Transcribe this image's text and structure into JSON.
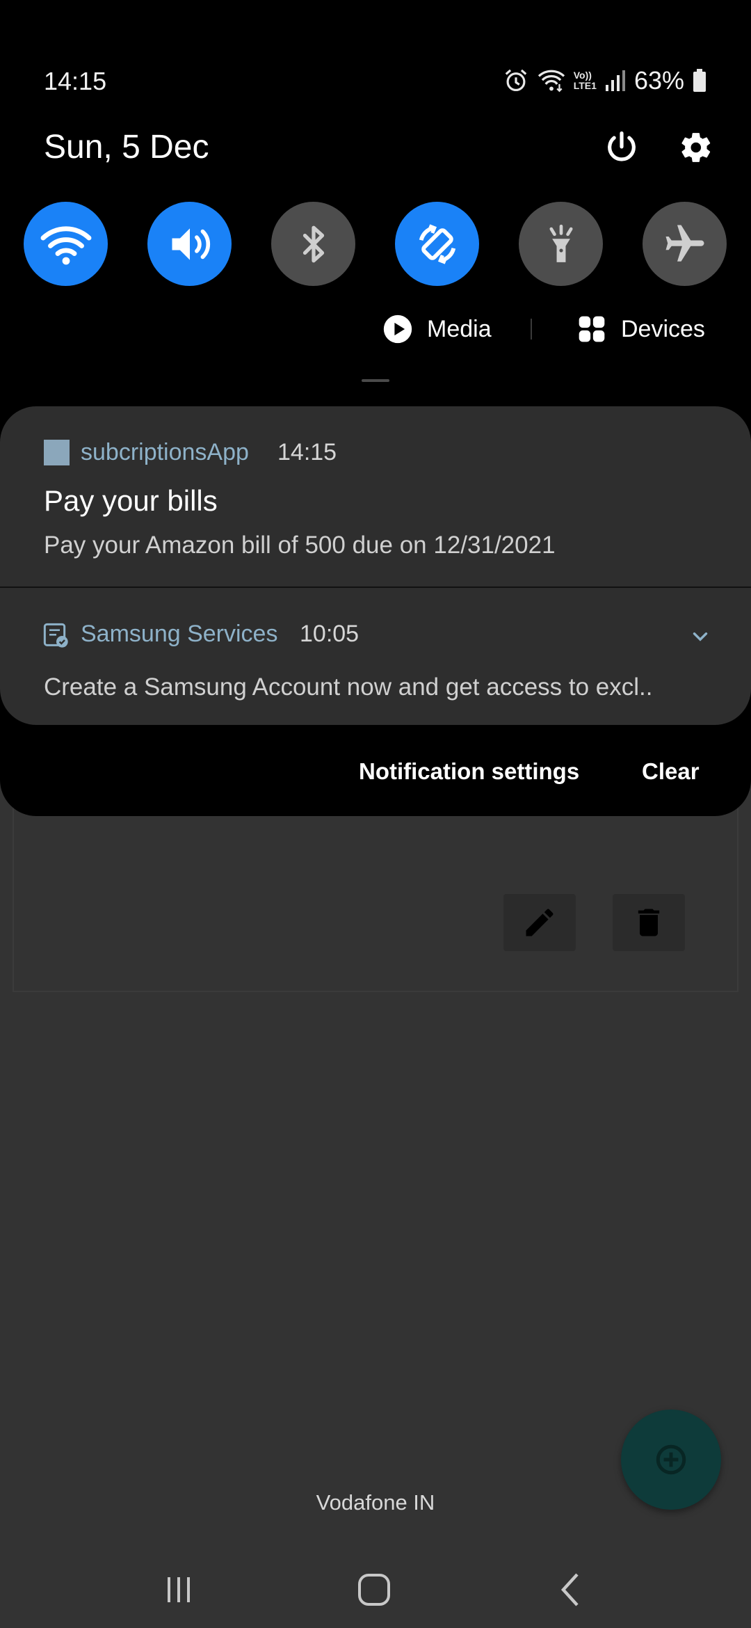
{
  "status_bar": {
    "time": "14:15",
    "battery_percent": "63%",
    "icons": [
      "alarm-icon",
      "wifi-calling-icon",
      "volte-lte1-icon",
      "signal-icon",
      "battery-icon"
    ],
    "volte_label_top": "Vo))",
    "volte_label_bottom": "LTE1"
  },
  "header": {
    "date": "Sun, 5 Dec",
    "power_icon": "power-icon",
    "settings_icon": "gear-icon"
  },
  "quick_settings": [
    {
      "name": "wifi",
      "icon": "wifi-icon",
      "on": true
    },
    {
      "name": "sound",
      "icon": "speaker-icon",
      "on": true
    },
    {
      "name": "bluetooth",
      "icon": "bluetooth-icon",
      "on": false
    },
    {
      "name": "auto-rotate",
      "icon": "rotate-icon",
      "on": true
    },
    {
      "name": "flashlight",
      "icon": "flashlight-icon",
      "on": false
    },
    {
      "name": "airplane-mode",
      "icon": "airplane-icon",
      "on": false
    }
  ],
  "media_row": {
    "media_label": "Media",
    "devices_label": "Devices"
  },
  "notifications": [
    {
      "app": "subcriptionsApp",
      "time": "14:15",
      "title": "Pay your bills",
      "body": "Pay your Amazon  bill of 500 due on 12/31/2021"
    },
    {
      "app": "Samsung Services",
      "time": "10:05",
      "body": "Create a Samsung Account now and get access to excl.."
    }
  ],
  "shade_actions": {
    "settings_label": "Notification settings",
    "clear_label": "Clear"
  },
  "background_app": {
    "edit_icon": "pencil-icon",
    "delete_icon": "trash-icon",
    "fab_icon": "add-circle-icon"
  },
  "carrier": "Vodafone IN",
  "colors": {
    "tile_on": "#1a82f7",
    "tile_off": "#4d4d4d",
    "app_name": "#8eb2c9",
    "shade_bg": "#000000",
    "card_bg": "#2e2e2e"
  }
}
